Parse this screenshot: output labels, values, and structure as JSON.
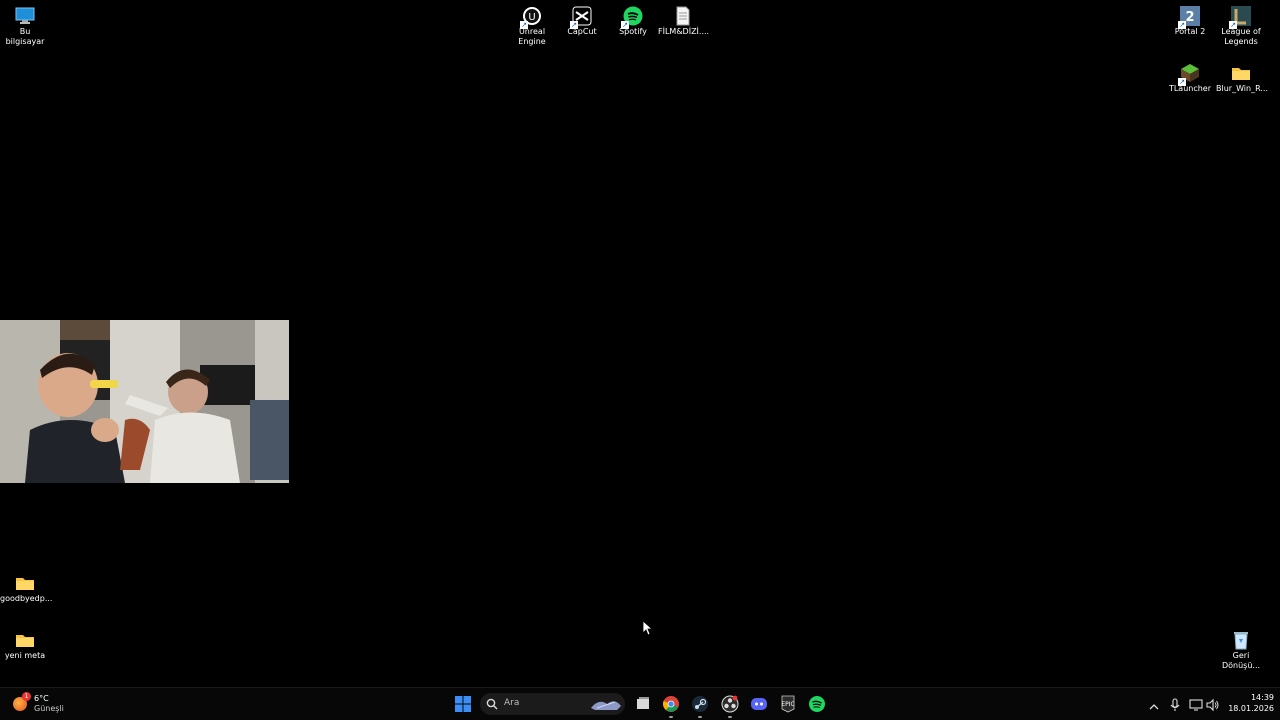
{
  "desktop": {
    "icons": {
      "this_pc": "Bu bilgisayar",
      "unreal": "Unreal\nEngine",
      "capcut": "CapCut",
      "spotify": "Spotify",
      "film": "FİLM&DİZİ....",
      "portal2": "Portal 2",
      "lol": "League of\nLegends",
      "tlauncher": "TLauncher",
      "blur": "Blur_Win_R...",
      "goodbye": "goodbyedp...",
      "yeni_meta": "yeni meta",
      "recycle": "Geri\nDönüşü..."
    }
  },
  "webcam": {
    "icon": "webcam-feed"
  },
  "taskbar": {
    "weather": {
      "temp": "6°C",
      "condition": "Güneşli",
      "badge": "1"
    },
    "search": {
      "placeholder": "Ara"
    },
    "clock": {
      "time": "14:39",
      "date": "18.01.2026"
    },
    "pinned": [
      "start",
      "search",
      "task-view",
      "chrome",
      "steam",
      "obs",
      "discord",
      "epic-games",
      "spotify"
    ],
    "tray": [
      "chevron-up",
      "microphone",
      "network",
      "volume"
    ]
  },
  "colors": {
    "spotify": "#1ed760",
    "folder": "#f5c542",
    "windows_blue": "#3a8ef6",
    "discord": "#5865f2"
  }
}
